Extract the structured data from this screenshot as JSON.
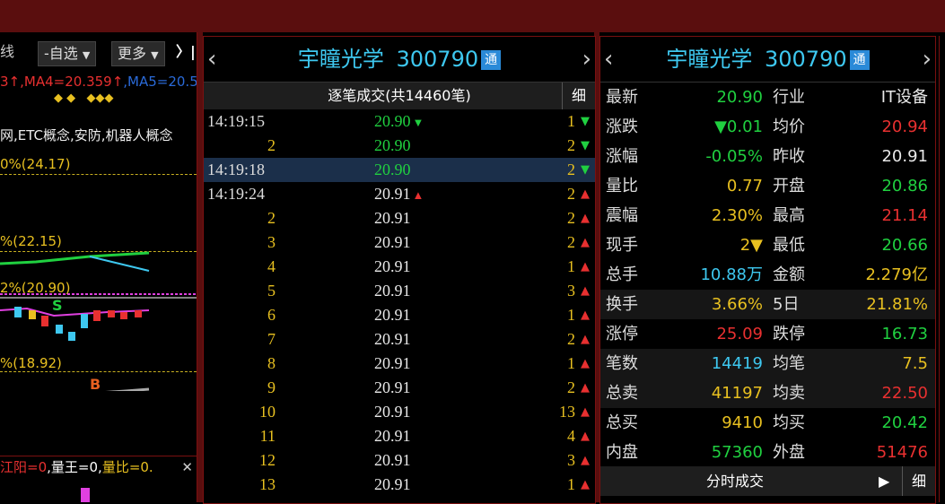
{
  "colors": {
    "up": "#e83030",
    "down": "#20d040",
    "neutral": "#e8c020",
    "cyan": "#3ec8f0",
    "accent_bar": "#5a0e0e"
  },
  "left": {
    "toolbar": {
      "line_label": "线",
      "zixuan_label": "-自选",
      "more_label": "更多",
      "collapse_label": "〉|"
    },
    "ma_legend": {
      "ma3_tail": "3↑",
      "ma4": ",MA4=20.359↑",
      "ma5": ",MA5=20.5"
    },
    "concepts": "网,ETC概念,安防,机器人概念",
    "levels": [
      "0%(24.17)",
      "%(22.15)",
      "2%(20.90)",
      "%(18.92)"
    ],
    "markers": {
      "s": "S",
      "b": "B"
    },
    "bottom": {
      "a": "江阳=0",
      "b": "量王=0",
      "c": "量比=0.",
      "close": "✕"
    }
  },
  "middle": {
    "stock_name": "宇瞳光学",
    "stock_code": "300790",
    "tong": "通",
    "title": "逐笔成交(共14460笔)",
    "detail": "细",
    "trades": [
      {
        "time": "14:19:15",
        "price": "20.90",
        "dir": "down",
        "vol": "1",
        "vdir": "down"
      },
      {
        "time": "2",
        "price": "20.90",
        "dir": "",
        "vol": "2",
        "vdir": "down"
      },
      {
        "time": "14:19:18",
        "price": "20.90",
        "dir": "",
        "vol": "2",
        "vdir": "down",
        "selected": true
      },
      {
        "time": "14:19:24",
        "price": "20.91",
        "dir": "up",
        "vol": "2",
        "vdir": "up"
      },
      {
        "time": "2",
        "price": "20.91",
        "dir": "",
        "vol": "2",
        "vdir": "up"
      },
      {
        "time": "3",
        "price": "20.91",
        "dir": "",
        "vol": "2",
        "vdir": "up"
      },
      {
        "time": "4",
        "price": "20.91",
        "dir": "",
        "vol": "1",
        "vdir": "up"
      },
      {
        "time": "5",
        "price": "20.91",
        "dir": "",
        "vol": "3",
        "vdir": "up"
      },
      {
        "time": "6",
        "price": "20.91",
        "dir": "",
        "vol": "1",
        "vdir": "up"
      },
      {
        "time": "7",
        "price": "20.91",
        "dir": "",
        "vol": "2",
        "vdir": "up"
      },
      {
        "time": "8",
        "price": "20.91",
        "dir": "",
        "vol": "1",
        "vdir": "up"
      },
      {
        "time": "9",
        "price": "20.91",
        "dir": "",
        "vol": "2",
        "vdir": "up"
      },
      {
        "time": "10",
        "price": "20.91",
        "dir": "",
        "vol": "13",
        "vdir": "up"
      },
      {
        "time": "11",
        "price": "20.91",
        "dir": "",
        "vol": "4",
        "vdir": "up"
      },
      {
        "time": "12",
        "price": "20.91",
        "dir": "",
        "vol": "3",
        "vdir": "up"
      },
      {
        "time": "13",
        "price": "20.91",
        "dir": "",
        "vol": "1",
        "vdir": "up"
      }
    ]
  },
  "right": {
    "stock_name": "宇瞳光学",
    "stock_code": "300790",
    "tong": "通",
    "rows": [
      {
        "l1": "最新",
        "v1": "20.90",
        "c1": "down",
        "l2": "行业",
        "v2": "IT设备",
        "c2": "white"
      },
      {
        "l1": "涨跌",
        "v1": "▼0.01",
        "c1": "down",
        "l2": "均价",
        "v2": "20.94",
        "c2": "up"
      },
      {
        "l1": "涨幅",
        "v1": "-0.05%",
        "c1": "down",
        "l2": "昨收",
        "v2": "20.91",
        "c2": "white"
      },
      {
        "l1": "量比",
        "v1": "0.77",
        "c1": "neutral",
        "l2": "开盘",
        "v2": "20.86",
        "c2": "down"
      },
      {
        "l1": "震幅",
        "v1": "2.30%",
        "c1": "neutral",
        "l2": "最高",
        "v2": "21.14",
        "c2": "up"
      },
      {
        "l1": "现手",
        "v1": "2▼",
        "c1": "neutral",
        "l2": "最低",
        "v2": "20.66",
        "c2": "down"
      },
      {
        "l1": "总手",
        "v1": "10.88万",
        "c1": "cyan",
        "l2": "金额",
        "v2": "2.279亿",
        "c2": "neutral"
      },
      {
        "l1": "换手",
        "v1": "3.66%",
        "c1": "neutral",
        "l2": "5日",
        "v2": "21.81%",
        "c2": "neutral"
      },
      {
        "l1": "涨停",
        "v1": "25.09",
        "c1": "up",
        "l2": "跌停",
        "v2": "16.73",
        "c2": "down"
      },
      {
        "l1": "笔数",
        "v1": "14419",
        "c1": "cyan",
        "l2": "均笔",
        "v2": "7.5",
        "c2": "neutral"
      },
      {
        "l1": "总卖",
        "v1": "41197",
        "c1": "neutral",
        "l2": "均卖",
        "v2": "22.50",
        "c2": "up"
      },
      {
        "l1": "总买",
        "v1": "9410",
        "c1": "neutral",
        "l2": "均买",
        "v2": "20.42",
        "c2": "down"
      },
      {
        "l1": "内盘",
        "v1": "57360",
        "c1": "down",
        "l2": "外盘",
        "v2": "51476",
        "c2": "up"
      }
    ],
    "footer": {
      "label": "分时成交",
      "play": "▶",
      "detail": "细"
    }
  }
}
